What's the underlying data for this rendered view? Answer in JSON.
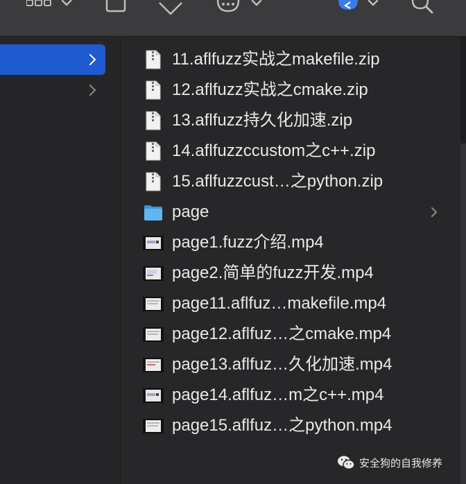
{
  "files": [
    {
      "name": "11.aflfuzz实战之makefile.zip",
      "type": "zip"
    },
    {
      "name": "12.aflfuzz实战之cmake.zip",
      "type": "zip"
    },
    {
      "name": "13.aflfuzz持久化加速.zip",
      "type": "zip"
    },
    {
      "name": "14.aflfuzzccustom之c++.zip",
      "type": "zip"
    },
    {
      "name": "15.aflfuzzcust…之python.zip",
      "type": "zip"
    },
    {
      "name": "page",
      "type": "folder"
    },
    {
      "name": "page1.fuzz介绍.mp4",
      "type": "video"
    },
    {
      "name": "page2.简单的fuzz开发.mp4",
      "type": "video"
    },
    {
      "name": "page11.aflfuz…makefile.mp4",
      "type": "video"
    },
    {
      "name": "page12.aflfuz…之cmake.mp4",
      "type": "video"
    },
    {
      "name": "page13.aflfuz…久化加速.mp4",
      "type": "video"
    },
    {
      "name": "page14.aflfuz…m之c++.mp4",
      "type": "video"
    },
    {
      "name": "page15.aflfuz…之python.mp4",
      "type": "video"
    }
  ],
  "watermark": {
    "text": "安全狗的自我修养"
  },
  "colors": {
    "selection": "#1f5bd0",
    "folder": "#5fb6f1",
    "background": "#272729"
  }
}
